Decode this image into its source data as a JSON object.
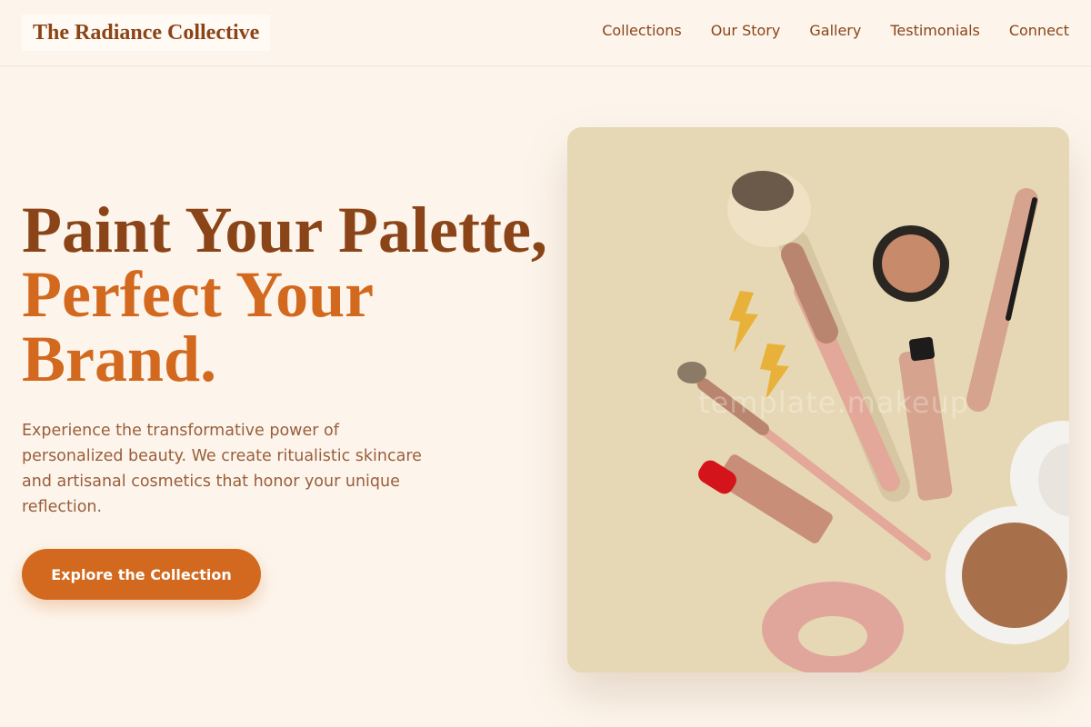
{
  "brand": {
    "name": "The Radiance Collective"
  },
  "nav": {
    "items": [
      {
        "label": "Collections"
      },
      {
        "label": "Our Story"
      },
      {
        "label": "Gallery"
      },
      {
        "label": "Testimonials"
      },
      {
        "label": "Connect"
      }
    ]
  },
  "hero": {
    "headline_line1": "Paint Your Palette,",
    "headline_line2": "Perfect Your",
    "headline_line3": "Brand.",
    "description": "Experience the transformative power of personalized beauty. We create ritualistic skincare and artisanal cosmetics that honor your unique reflection.",
    "cta_label": "Explore the Collection",
    "image_watermark": "template.makeup"
  },
  "colors": {
    "background": "#fdf5ec",
    "brand_brown": "#8a4417",
    "accent_orange": "#d2691e",
    "body_text": "#9a5e3a",
    "image_bg": "#e6d8b5"
  }
}
